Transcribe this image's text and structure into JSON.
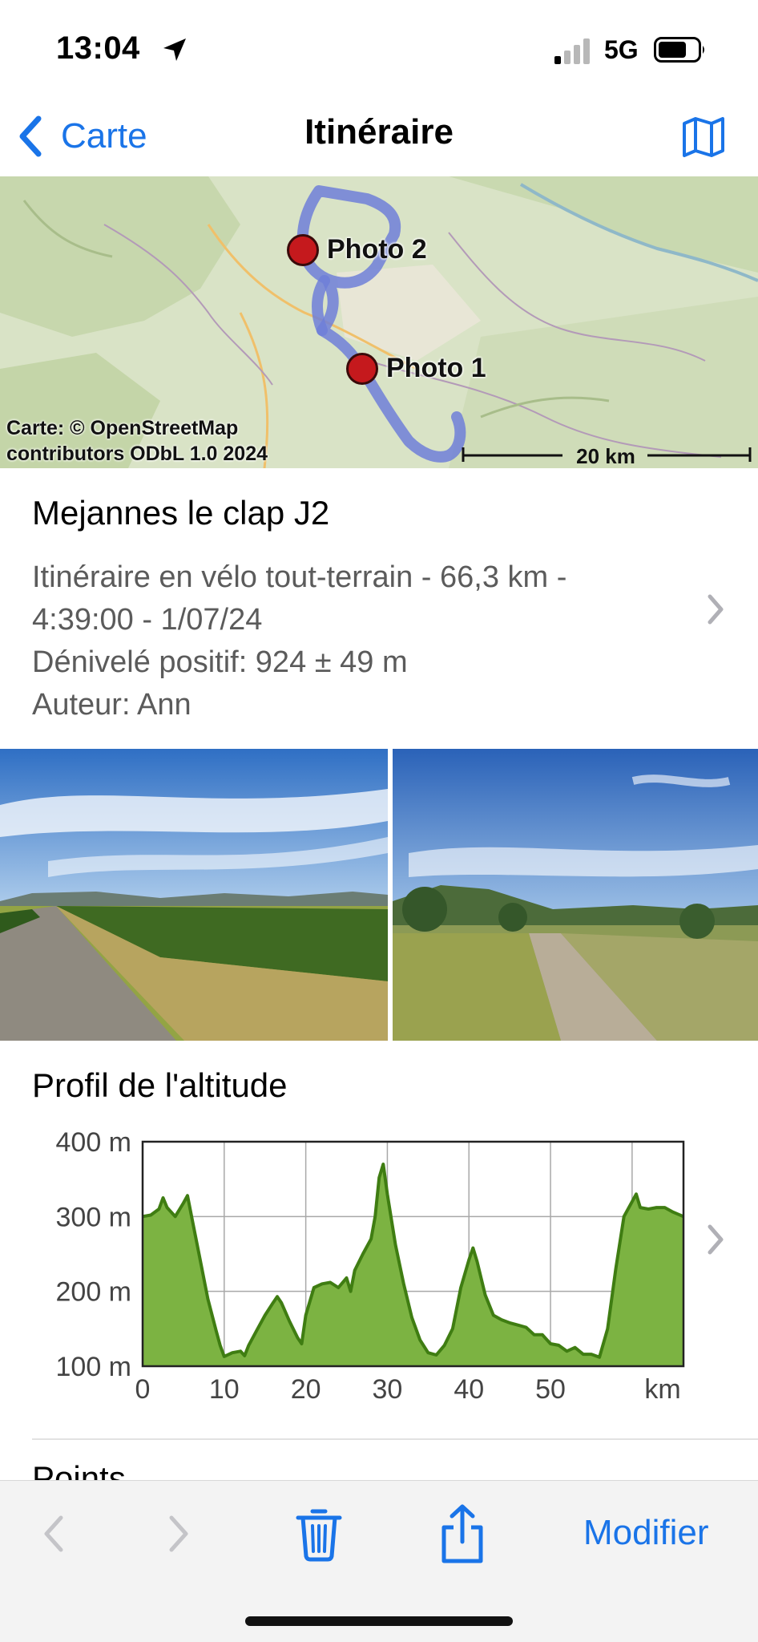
{
  "status_bar": {
    "time": "13:04",
    "network": "5G"
  },
  "nav": {
    "back_label": "Carte",
    "title": "Itinéraire"
  },
  "map": {
    "markers": [
      {
        "label": "Photo 2"
      },
      {
        "label": "Photo 1"
      }
    ],
    "attribution_line1": "Carte: © OpenStreetMap",
    "attribution_line2": "contributors ODbL 1.0 2024",
    "scale_label": "20 km"
  },
  "route": {
    "name": "Mejannes le clap J2",
    "detail_line1": "Itinéraire en vélo tout-terrain - 66,3 km -",
    "detail_line2": "4:39:00 - 1/07/24",
    "elevation_line": "Dénivelé positif: 924 ± 49 m",
    "author_line": "Auteur: Ann"
  },
  "altitude": {
    "title": "Profil de l'altitude",
    "y_tick_labels": [
      "400 m",
      "300 m",
      "200 m",
      "100 m"
    ],
    "x_tick_labels": [
      "0",
      "10",
      "20",
      "30",
      "40",
      "50",
      "km"
    ]
  },
  "chart_data": {
    "type": "area",
    "title": "Profil de l'altitude",
    "xlabel": "km",
    "ylabel": "",
    "xlim": [
      0,
      66.3
    ],
    "ylim": [
      100,
      400
    ],
    "x_ticks": [
      0,
      10,
      20,
      30,
      40,
      50
    ],
    "y_ticks": [
      100,
      200,
      300,
      400
    ],
    "grid": true,
    "series": [
      {
        "x": [
          0,
          1,
          2,
          2.5,
          3,
          4,
          5,
          5.5,
          6,
          7,
          8,
          9,
          9.5,
          10,
          11,
          12,
          12.5,
          13,
          14,
          15,
          16,
          16.5,
          17,
          18,
          19,
          19.5,
          20,
          21,
          22,
          23,
          24,
          25,
          25.5,
          26,
          27,
          28,
          28.5,
          29,
          29.5,
          30,
          31,
          32,
          33,
          34,
          35,
          36,
          37,
          38,
          39,
          40,
          40.5,
          41,
          42,
          43,
          44,
          45,
          46,
          47,
          48,
          49,
          50,
          51,
          52,
          53,
          54,
          55,
          56,
          57,
          58,
          59,
          60,
          60.5,
          61,
          62,
          63,
          64,
          65,
          66.3
        ],
        "y": [
          300,
          302,
          310,
          325,
          312,
          300,
          318,
          328,
          300,
          245,
          190,
          148,
          128,
          113,
          118,
          120,
          114,
          128,
          148,
          168,
          185,
          193,
          185,
          160,
          138,
          130,
          168,
          205,
          210,
          212,
          205,
          218,
          200,
          228,
          250,
          270,
          300,
          352,
          370,
          330,
          262,
          210,
          165,
          135,
          118,
          115,
          128,
          150,
          205,
          242,
          258,
          240,
          195,
          168,
          162,
          158,
          155,
          152,
          142,
          142,
          130,
          128,
          120,
          125,
          116,
          116,
          112,
          150,
          230,
          300,
          320,
          330,
          312,
          310,
          312,
          312,
          306,
          300
        ]
      }
    ]
  },
  "points_heading": "Points",
  "toolbar": {
    "edit_label": "Modifier"
  },
  "colors": {
    "accent": "#1a74e8",
    "route_line": "#6f7fd8",
    "marker": "#c5191d",
    "profile_fill": "#7cb342",
    "profile_line": "#3f7d12"
  }
}
